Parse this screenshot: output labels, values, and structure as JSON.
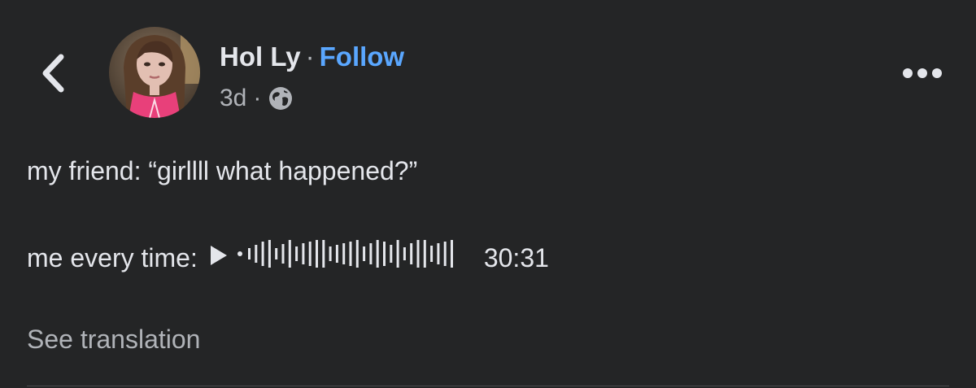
{
  "post": {
    "author_name": "Hol Ly",
    "name_separator": "·",
    "follow_label": "Follow",
    "timestamp": "3d",
    "meta_separator": "·",
    "privacy_icon": "globe-icon",
    "text_line_1": "my friend: “girllll what happened?”",
    "text_line_2_prefix": "me every time:",
    "voice_duration": "30:31",
    "see_translation_label": "See translation"
  },
  "icons": {
    "back": "chevron-left-icon",
    "more": "more-horizontal-icon",
    "play": "play-icon"
  },
  "colors": {
    "background": "#242526",
    "text_primary": "#e4e6eb",
    "text_secondary": "#b0b3b8",
    "link": "#5aa7ff"
  }
}
